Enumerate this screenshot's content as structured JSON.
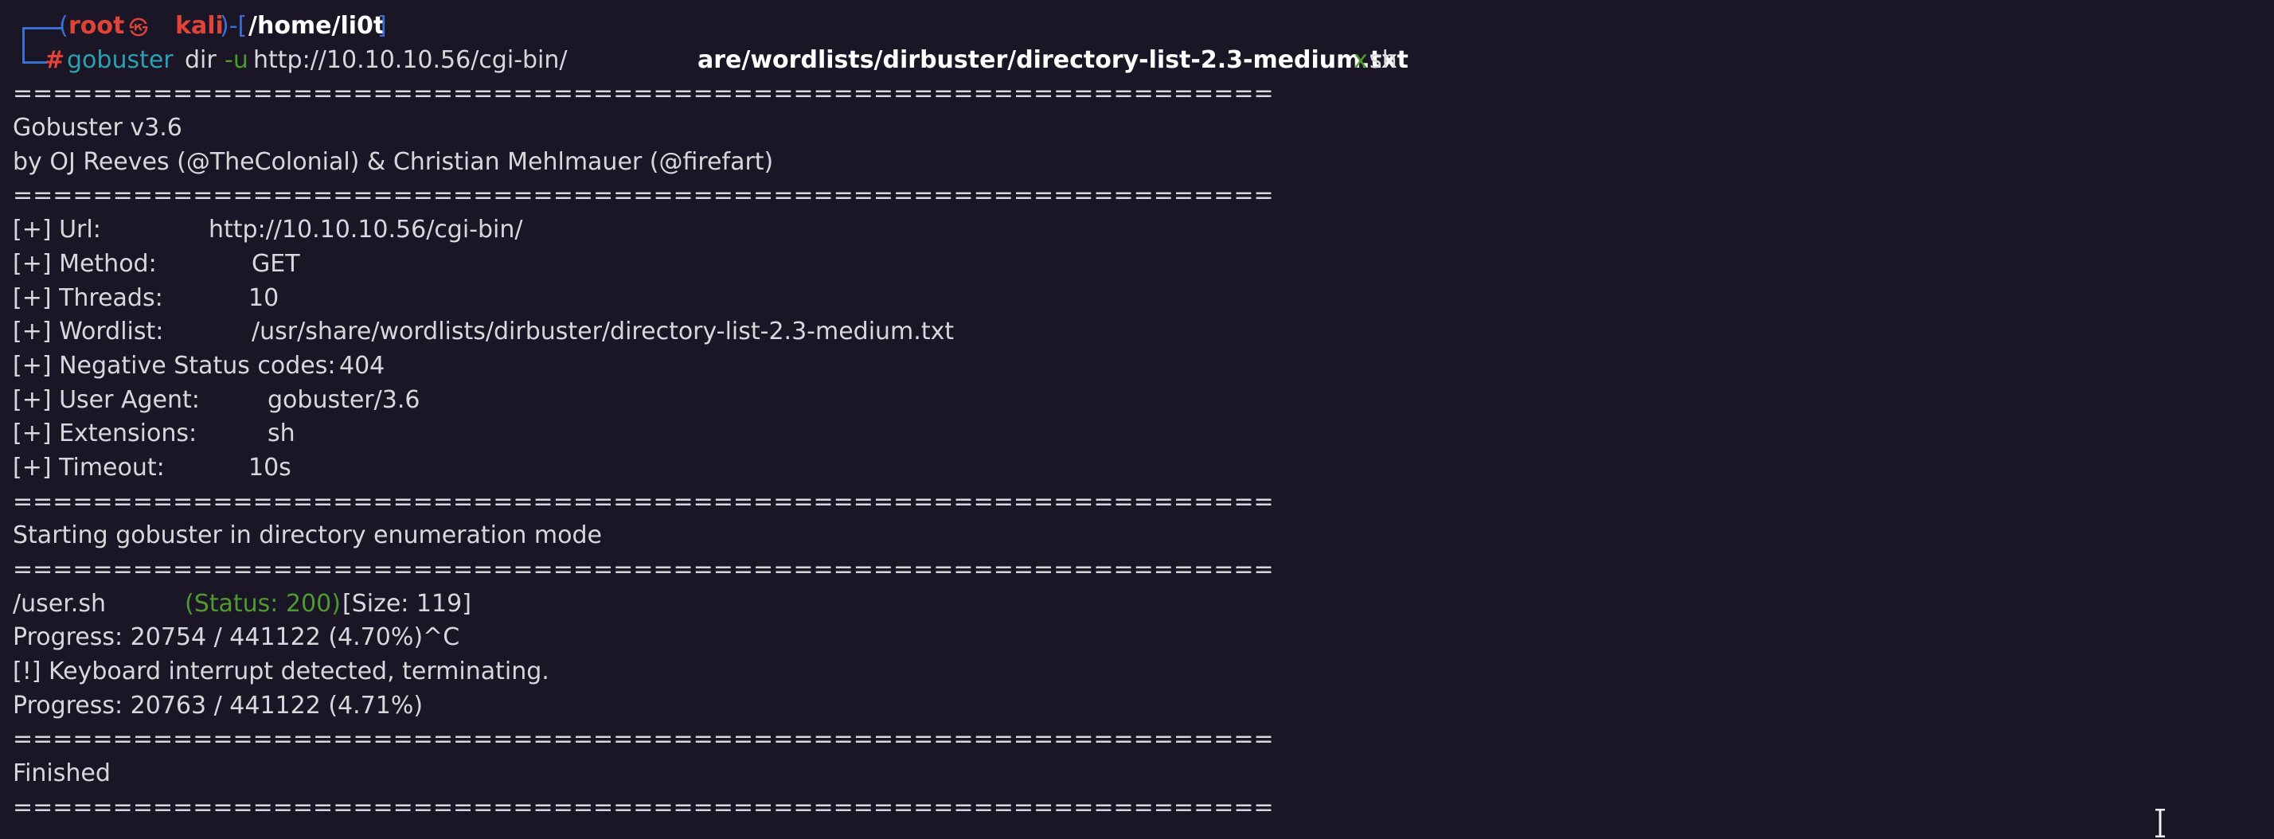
{
  "prompt": {
    "user": "root",
    "at_symbol": "㉿",
    "host": "kali",
    "path": "/home/li0t",
    "dash_open": ")-[",
    "open_paren": "(",
    "close_bracket": "]",
    "hash": "#",
    "command_tool": "gobuster",
    "command_sub": "dir",
    "flag_u": "-u",
    "url_arg": "http://10.10.10.56/cgi-bin/",
    "wordlist_partial": "are/wordlists/dirbuster/directory-list-2.3-medium.txt",
    "flag_x": "x",
    "ext_arg": "sh"
  },
  "output": {
    "rule": "===============================================================",
    "banner_title": "Gobuster v3.6",
    "banner_authors": "by OJ Reeves (@TheColonial) & Christian Mehlmauer (@firefart)",
    "config": [
      {
        "key": "[+] Url:",
        "value": "http://10.10.10.56/cgi-bin/"
      },
      {
        "key": "[+] Method:",
        "value": "GET"
      },
      {
        "key": "[+] Threads:",
        "value": "10"
      },
      {
        "key": "[+] Wordlist:",
        "value": "/usr/share/wordlists/dirbuster/directory-list-2.3-medium.txt"
      },
      {
        "key": "[+] Negative Status codes:",
        "value": "404"
      },
      {
        "key": "[+] User Agent:",
        "value": "gobuster/3.6"
      },
      {
        "key": "[+] Extensions:",
        "value": "sh"
      },
      {
        "key": "[+] Timeout:",
        "value": "10s"
      }
    ],
    "start_msg": "Starting gobuster in directory enumeration mode",
    "result_path": "/user.sh",
    "result_status": "(Status: 200)",
    "result_size": "[Size: 119]",
    "progress1": "Progress: 20754 / 441122 (4.70%)^C",
    "interrupt": "[!] Keyboard interrupt detected, terminating.",
    "progress2": "Progress: 20763 / 441122 (4.71%)",
    "finished": "Finished"
  }
}
